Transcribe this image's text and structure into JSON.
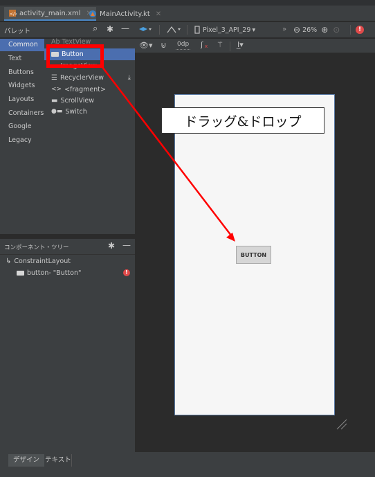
{
  "tabs": [
    {
      "label": "activity_main.xml",
      "active": true
    },
    {
      "label": "MainActivity.kt",
      "active": false
    }
  ],
  "palette": {
    "title": "パレット",
    "categories": [
      "Common",
      "Text",
      "Buttons",
      "Widgets",
      "Layouts",
      "Containers",
      "Google",
      "Legacy"
    ],
    "selected_category": "Common",
    "items": [
      "Ab TextView",
      "Button",
      "ImageView",
      "RecyclerView",
      "<fragment>",
      "ScrollView",
      "Switch"
    ],
    "selected_item": "Button"
  },
  "design_toolbar": {
    "device": "Pixel_3_API_29",
    "zoom": "26%",
    "margin": "0dp"
  },
  "component_tree": {
    "title": "コンポーネント・ツリー",
    "root": "ConstraintLayout",
    "child": "button- \"Button\""
  },
  "canvas": {
    "button_label": "BUTTON"
  },
  "annotation": {
    "callout": "ドラッグ&ドロップ"
  },
  "bottom_tabs": [
    "デザイン",
    "テキスト"
  ],
  "colors": {
    "annotation_red": "#ff0000",
    "selection_blue": "#4b6eaf"
  }
}
